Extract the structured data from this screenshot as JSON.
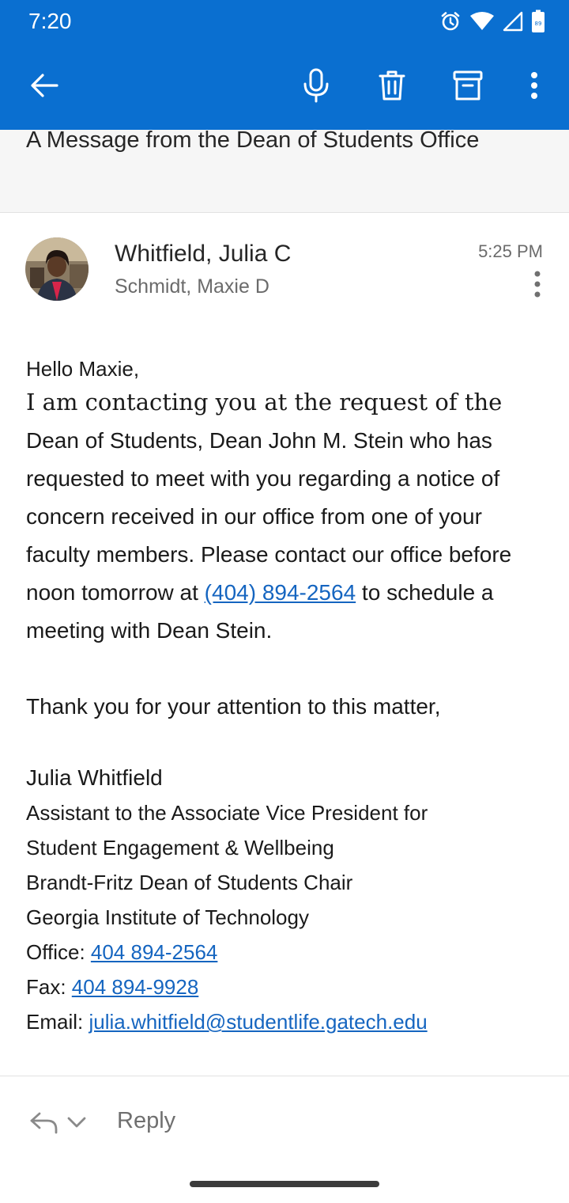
{
  "status_bar": {
    "time": "7:20",
    "battery_level": "89",
    "icons": [
      "alarm-icon",
      "wifi-icon",
      "cell-signal-icon",
      "battery-icon"
    ]
  },
  "app_bar": {
    "color": "#0a6fd0",
    "actions": [
      "back-arrow-icon",
      "microphone-icon",
      "trash-icon",
      "archive-icon",
      "overflow-menu-icon"
    ]
  },
  "email": {
    "subject": "A Message from the Dean of Students Office",
    "sender": "Whitfield, Julia C",
    "recipient": "Schmidt, Maxie D",
    "time": "5:25 PM",
    "greeting": "Hello Maxie,",
    "body": {
      "serif_intro": "I am contacting you at the request of the",
      "text_a": "Dean of Students, Dean John M. Stein who has requested to meet with you regarding a notice of concern received in our office from one of your faculty members. Please contact our office before noon tomorrow at  ",
      "phone_link": "(404) 894-2564",
      "text_b": " to schedule a meeting with Dean Stein."
    },
    "closing": "Thank you for your attention to this matter,",
    "signature": {
      "name": "Julia Whitfield",
      "title_1": "Assistant to the Associate Vice President for",
      "title_2": "Student Engagement & Wellbeing",
      "title_3": "Brandt-Fritz Dean of Students Chair",
      "org": "Georgia Institute of Technology",
      "office_label": "Office: ",
      "office_phone": "404 894-2564",
      "fax_label": "Fax: ",
      "fax": "404 894-9928",
      "email_label": "Email: ",
      "email": "julia.whitfield@studentlife.gatech.edu"
    }
  },
  "reply_bar": {
    "reply_label": "Reply"
  },
  "colors": {
    "accent": "#0a6fd0",
    "link": "#1565c0",
    "subject_band": "#f6f6f6"
  }
}
